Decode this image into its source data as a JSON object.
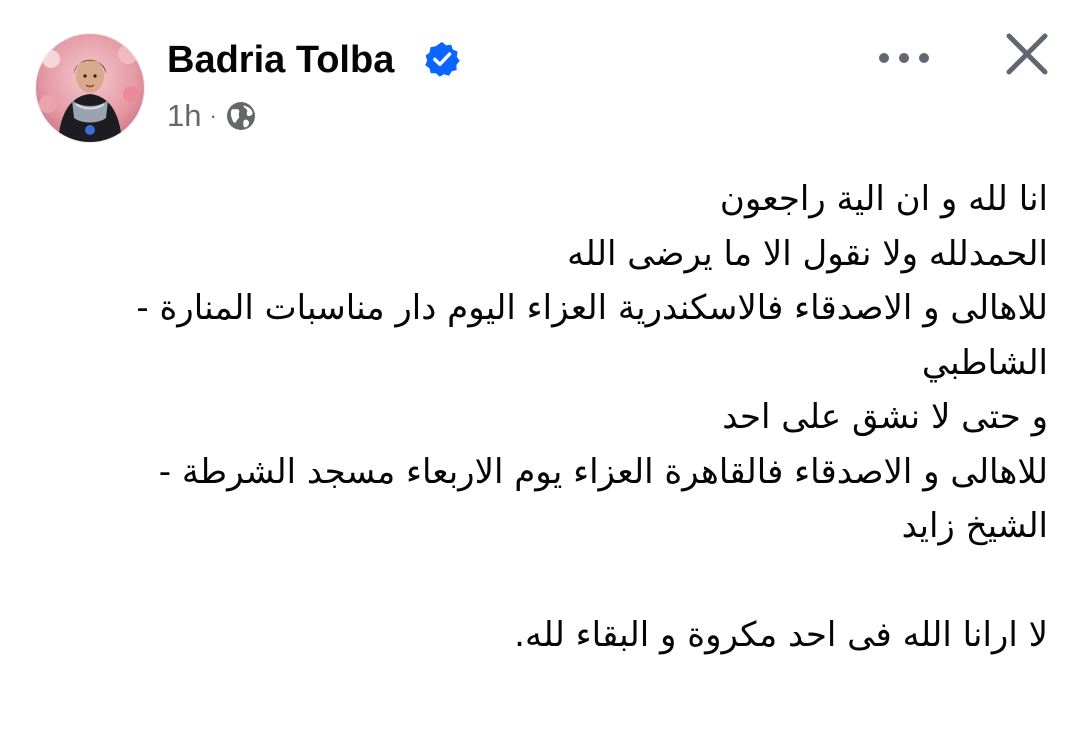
{
  "author": {
    "name": "Badria Tolba",
    "verified": true,
    "verified_icon": "verified-badge-icon",
    "avatar_icon": "profile-avatar"
  },
  "meta": {
    "time": "1h",
    "separator": "·",
    "audience_icon": "globe-icon"
  },
  "actions": {
    "more_icon": "more-options-icon",
    "close_icon": "close-icon"
  },
  "post": {
    "lines": [
      "انا لله و ان الية راجعون",
      "الحمدلله ولا نقول الا ما يرضى الله",
      "للاهالى و الاصدقاء فالاسكندرية العزاء اليوم دار مناسبات المنارة -",
      "الشاطبي",
      "و حتى لا نشق على احد",
      "للاهالى و الاصدقاء فالقاهرة العزاء يوم الاربعاء مسجد الشرطة -",
      "الشيخ زايد",
      "",
      "لا ارانا الله فى احد مكروة و البقاء لله."
    ]
  },
  "colors": {
    "text_primary": "#050505",
    "text_secondary": "#65676b",
    "verified_blue": "#0866ff",
    "icon_gray": "#606770"
  }
}
